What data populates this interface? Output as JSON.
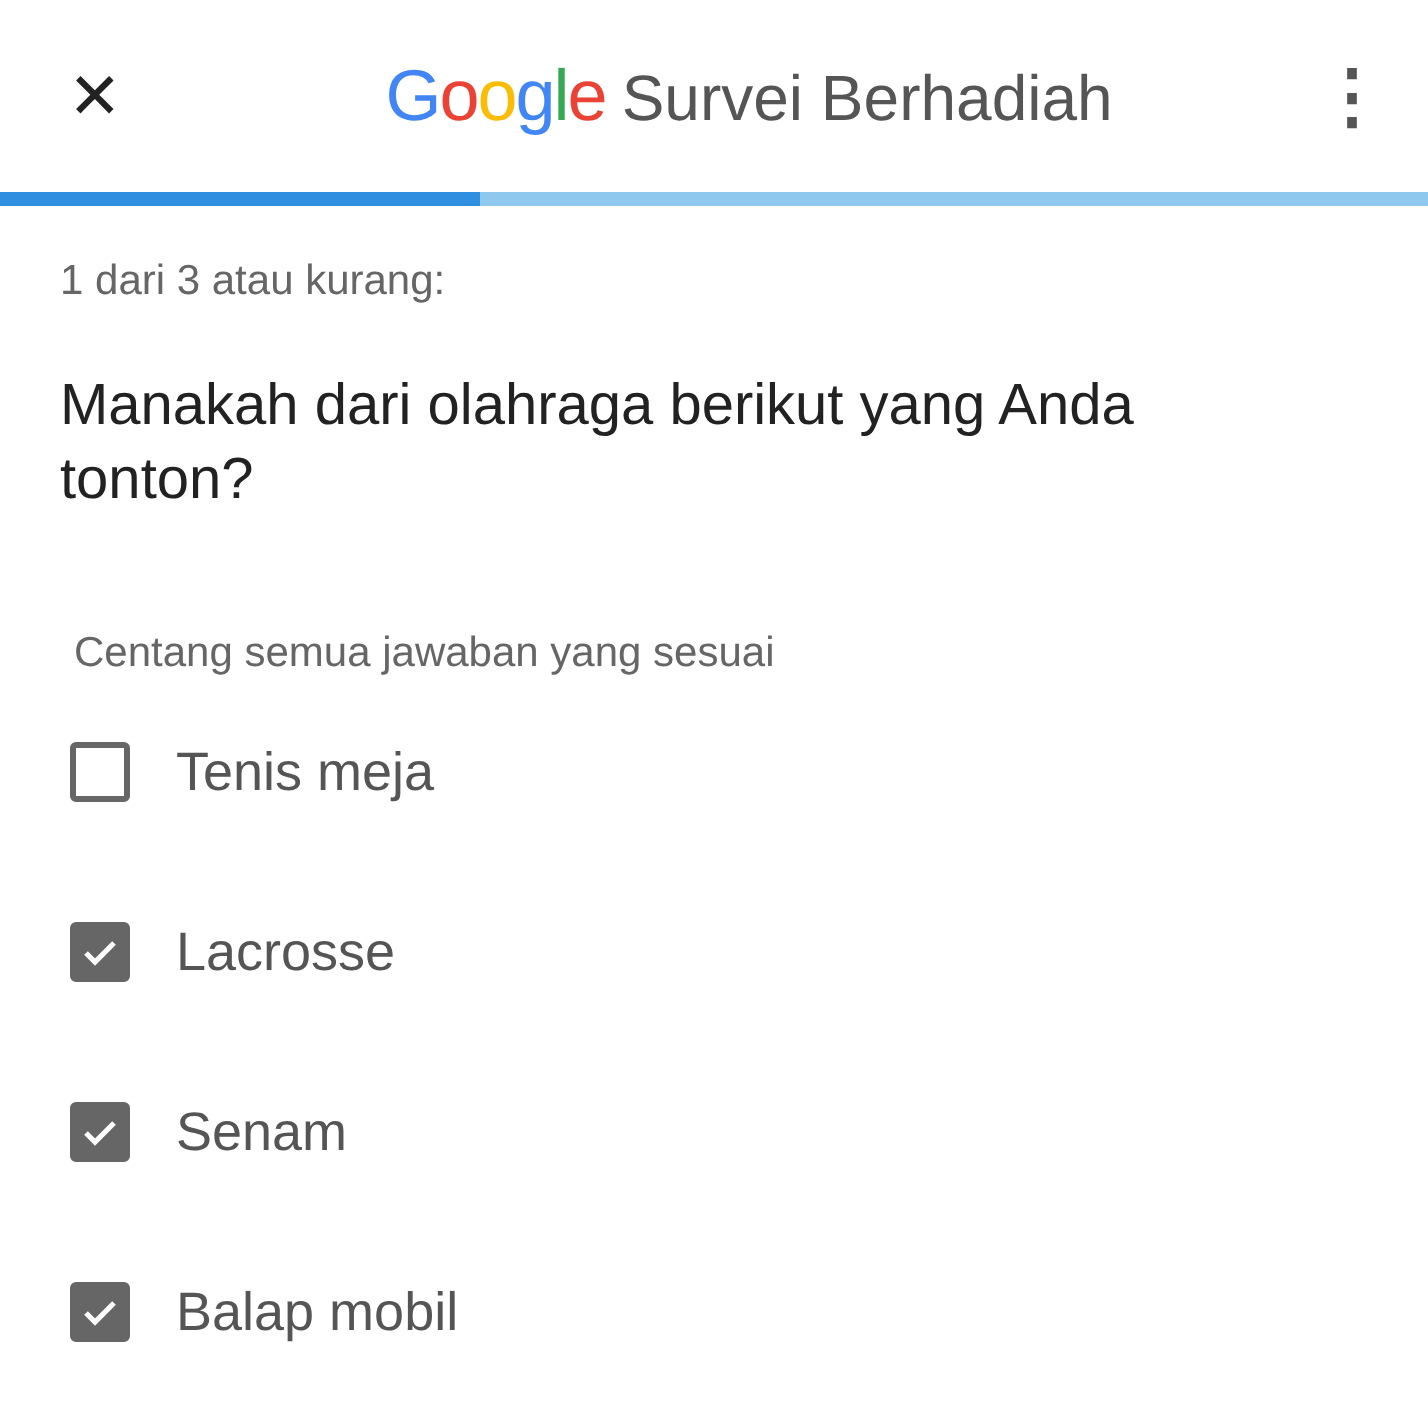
{
  "header": {
    "close": "✕",
    "brand": "Google",
    "title": "Survei Berhadiah",
    "menu": "⋮"
  },
  "progress": {
    "level": 0.336
  },
  "step": "1 dari 3 atau kurang:",
  "question": "Manakah dari olahraga berikut yang Anda tonton?",
  "instruction": "Centang semua jawaban yang sesuai",
  "options": [
    {
      "label": "Tenis meja",
      "checked": false
    },
    {
      "label": "Lacrosse",
      "checked": true
    },
    {
      "label": "Senam",
      "checked": true
    },
    {
      "label": "Balap mobil",
      "checked": true
    }
  ]
}
